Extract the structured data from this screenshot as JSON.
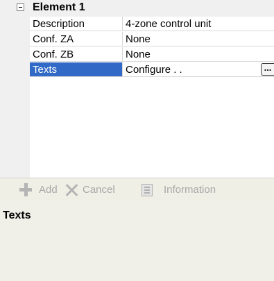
{
  "category": {
    "label": "Element 1",
    "collapse_icon": "minus-box-icon"
  },
  "properties": [
    {
      "name": "Description",
      "value": "4-zone control unit"
    },
    {
      "name": "Conf. ZA",
      "value": "None"
    },
    {
      "name": "Conf. ZB",
      "value": "None"
    },
    {
      "name": "Texts",
      "value": "Configure . .",
      "selected": true
    }
  ],
  "ellipsis_label": "...",
  "toolbar": {
    "add_label": "Add",
    "cancel_label": "Cancel",
    "information_label": "Information"
  },
  "info_panel": {
    "title": "Texts"
  },
  "colors": {
    "selection": "#3169c6",
    "toolbar_bg": "#efefe6",
    "disabled_text": "#a8a8a8"
  }
}
